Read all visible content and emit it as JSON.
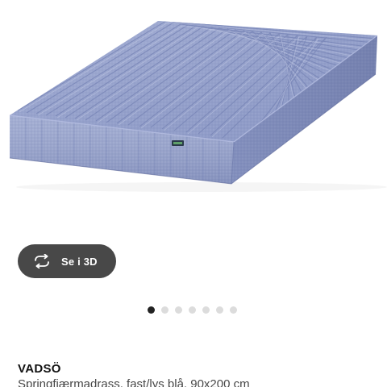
{
  "viewer": {
    "view_3d_label": "Se i 3D",
    "view_3d_icon": "rotate-arrows-icon",
    "carousel": {
      "count": 7,
      "active_index": 0
    }
  },
  "product": {
    "name": "VADSÖ",
    "description": "Springfjærmadrass, fast/lys blå, 90x200 cm"
  },
  "colors": {
    "mattress_blue": "#8f9dc8",
    "button_bg": "#484848",
    "dot_active": "#222222",
    "dot_inactive": "#dcdcdc"
  }
}
